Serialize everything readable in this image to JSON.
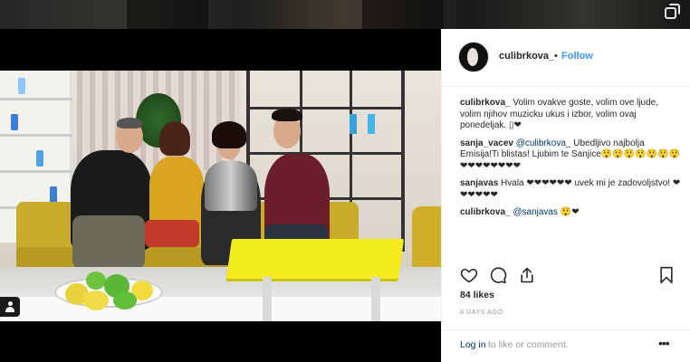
{
  "post": {
    "username": "culibrkova_",
    "separator": "•",
    "follow_label": "Follow"
  },
  "comments": [
    {
      "user": "culibrkova_",
      "pre": " Volim ovakve goste, volim ove ljude, volim njihov muzicku ukus i izbor, volim ovaj ponedeljak. ",
      "mention": "",
      "post": "▯❤"
    },
    {
      "user": "sanja_vacev",
      "pre": " ",
      "mention": "@culibrkova_",
      "post": " Ubedljivo najbolja Emisija!Ti blistas! Ljubim te Sanjice😲😲😲😲😲😲😲❤❤❤❤❤❤❤❤"
    },
    {
      "user": "sanjavas",
      "pre": " Hvala ❤❤❤❤❤❤ uvek mi je zadovoljstvo! ❤❤❤❤❤❤",
      "mention": "",
      "post": ""
    },
    {
      "user": "culibrkova_",
      "pre": " ",
      "mention": "@sanjavas",
      "post": " 😲❤"
    }
  ],
  "likes_text": "84 likes",
  "time_ago": "6 DAYS AGO",
  "footer": {
    "login_label": "Log in",
    "rest_text": " to like or comment.",
    "more_label": "•••"
  },
  "icons": {
    "like": "heart-icon",
    "comment": "comment-icon",
    "share": "share-icon",
    "save": "bookmark-icon",
    "multi": "multiple-posts-icon",
    "tagged": "user-tag-icon"
  },
  "colors": {
    "link_blue": "#3897f0",
    "text": "#262626",
    "muted": "#999999",
    "mention": "#003569"
  }
}
